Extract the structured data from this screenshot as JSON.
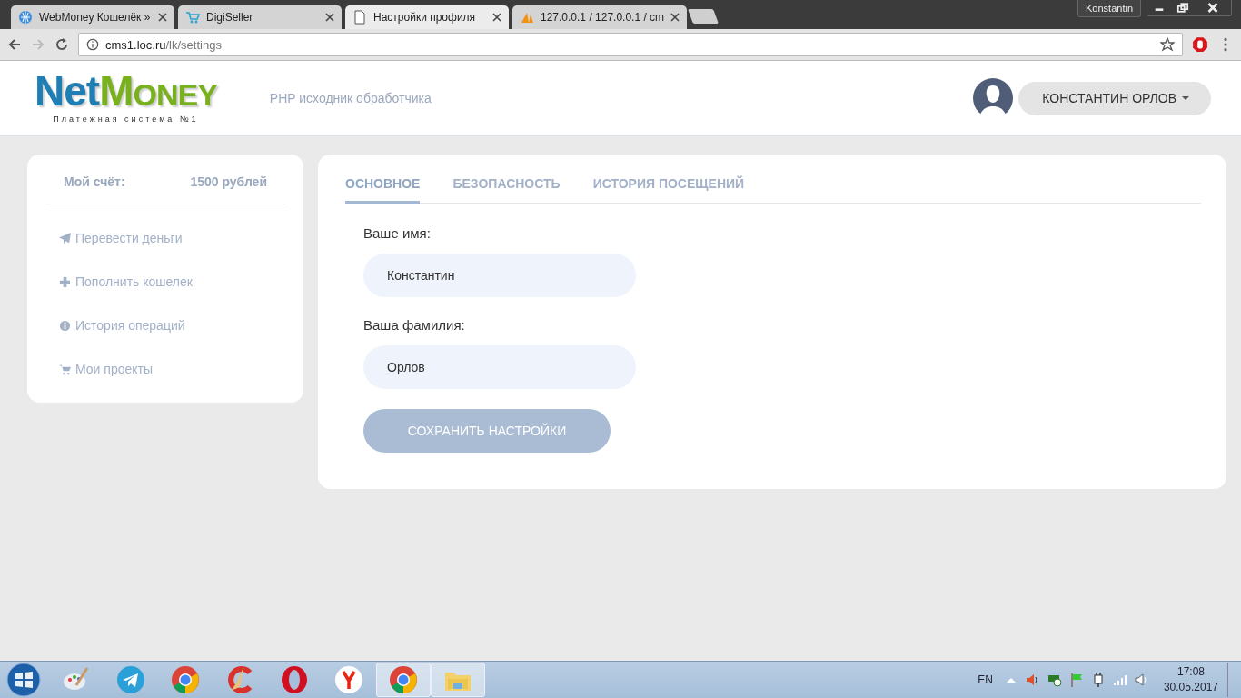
{
  "browser": {
    "tabs": [
      {
        "title": "WebMoney Кошелёк »",
        "kind": "globe",
        "selected": false
      },
      {
        "title": "DigiSeller",
        "kind": "cart",
        "selected": false
      },
      {
        "title": "Настройки профиля",
        "kind": "page",
        "selected": true
      },
      {
        "title": "127.0.0.1 / 127.0.0.1 / cm",
        "kind": "pma",
        "selected": false
      }
    ],
    "profile": "Konstantin",
    "url_host": "cms1.loc.ru",
    "url_path": "/lk/settings"
  },
  "header": {
    "logo_first": "Net",
    "logo_second_initial": "M",
    "logo_second_rest": "ONEY",
    "logo_tagline": "Платежная система №1",
    "subtitle": "PHP исходник обработчика",
    "user_name": "КОНСТАНТИН ОРЛОВ"
  },
  "sidebar": {
    "balance_label": "Мой счёт:",
    "balance_value": "1500 рублей",
    "items": [
      {
        "label": "Перевести деньги",
        "kind": "send"
      },
      {
        "label": "Пополнить кошелек",
        "kind": "plus"
      },
      {
        "label": "История операций",
        "kind": "info"
      },
      {
        "label": "Мои проекты",
        "kind": "cart"
      }
    ]
  },
  "settings": {
    "tabs": [
      {
        "label": "ОСНОВНОЕ",
        "selected": true
      },
      {
        "label": "БЕЗОПАСНОСТЬ",
        "selected": false
      },
      {
        "label": "ИСТОРИЯ ПОСЕЩЕНИЙ",
        "selected": false
      }
    ],
    "fields": [
      {
        "label": "Ваше имя:",
        "value": "Константин"
      },
      {
        "label": "Ваша фамилия:",
        "value": "Орлов"
      }
    ],
    "save_button": "СОХРАНИТЬ НАСТРОЙКИ"
  },
  "taskbar": {
    "apps": [
      {
        "kind": "paint",
        "selected": false
      },
      {
        "kind": "telegram",
        "selected": false
      },
      {
        "kind": "chrome",
        "selected": false
      },
      {
        "kind": "ccleaner",
        "selected": false
      },
      {
        "kind": "opera",
        "selected": false
      },
      {
        "kind": "yandex",
        "selected": false
      },
      {
        "kind": "chrome",
        "selected": true
      },
      {
        "kind": "folder",
        "selected": true
      }
    ],
    "language": "EN",
    "time": "17:08",
    "date": "30.05.2017"
  }
}
